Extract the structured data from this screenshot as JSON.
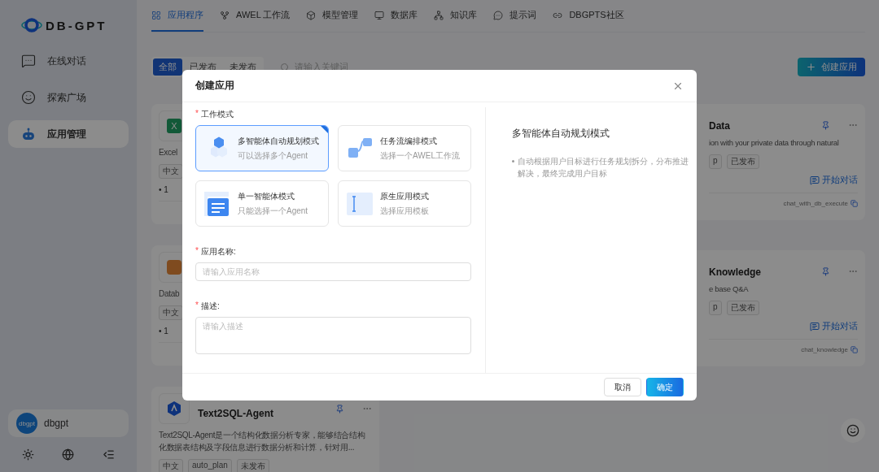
{
  "sidebar": {
    "logo": "DB-GPT",
    "items": [
      {
        "label": "在线对话",
        "selected": false
      },
      {
        "label": "探索广场",
        "selected": false
      },
      {
        "label": "应用管理",
        "selected": true
      }
    ],
    "user": {
      "avatar": "dbgpt",
      "name": "dbgpt"
    }
  },
  "top_nav": [
    {
      "label": "应用程序",
      "selected": true
    },
    {
      "label": "AWEL 工作流",
      "selected": false
    },
    {
      "label": "模型管理",
      "selected": false
    },
    {
      "label": "数据库",
      "selected": false
    },
    {
      "label": "知识库",
      "selected": false
    },
    {
      "label": "提示词",
      "selected": false
    },
    {
      "label": "DBGPTS社区",
      "selected": false
    }
  ],
  "filter": {
    "tabs": [
      {
        "label": "全部",
        "selected": true
      },
      {
        "label": "已发布",
        "selected": false
      },
      {
        "label": "未发布",
        "selected": false
      }
    ],
    "search_placeholder": "请输入关键词"
  },
  "create_button": "创建应用",
  "left_cards": [
    {
      "kind": "excel",
      "logo_text": "X",
      "description": "Excel",
      "tags": [
        "中文"
      ],
      "meta": "• 1"
    },
    {
      "kind": "hex",
      "description": "Datab",
      "tags": [
        "中文"
      ],
      "meta": "• 1"
    },
    {
      "kind": "agent",
      "title": "Text2SQL-Agent",
      "description": "Text2SQL-Agent是一个结构化数据分析专家，能够结合结构化数据表结构及字段信息进行数据分析和计算，针对用...",
      "tags": [
        "中文",
        "auto_plan",
        "未发布"
      ]
    }
  ],
  "right_cards": [
    {
      "title": "Data",
      "description": "ion with your private data through natural",
      "tags": [
        "p",
        "已发布"
      ],
      "action": "开始对话",
      "footer": "chat_with_db_execute"
    },
    {
      "title": "Knowledge",
      "description": "e base Q&A",
      "tags": [
        "p",
        "已发布"
      ],
      "action": "开始对话",
      "footer": "chat_knowledge"
    }
  ],
  "modal": {
    "title": "创建应用",
    "mode_label": {
      "required_mark": "*",
      "label": "工作模式"
    },
    "modes": [
      {
        "kind": "hexagons",
        "title": "多智能体自动规划模式",
        "subtitle": "可以选择多个Agent",
        "selected": true
      },
      {
        "kind": "flow",
        "title": "任务流编排模式",
        "subtitle": "选择一个AWEL工作流",
        "selected": false
      },
      {
        "kind": "single",
        "title": "单一智能体模式",
        "subtitle": "只能选择一个Agent",
        "selected": false
      },
      {
        "kind": "native",
        "title": "原生应用模式",
        "subtitle": "选择应用模板",
        "selected": false
      }
    ],
    "fields": [
      {
        "kind": "input",
        "required_mark": "*",
        "label": "应用名称:",
        "placeholder": "请输入应用名称"
      },
      {
        "kind": "textarea",
        "required_mark": "*",
        "label": "描述:",
        "placeholder": "请输入描述"
      }
    ],
    "detail": {
      "title": "多智能体自动规划模式",
      "bullet": "自动根据用户目标进行任务规划拆分，分布推进解决，最终完成用户目标"
    },
    "cancel": "取消",
    "ok": "确定"
  }
}
